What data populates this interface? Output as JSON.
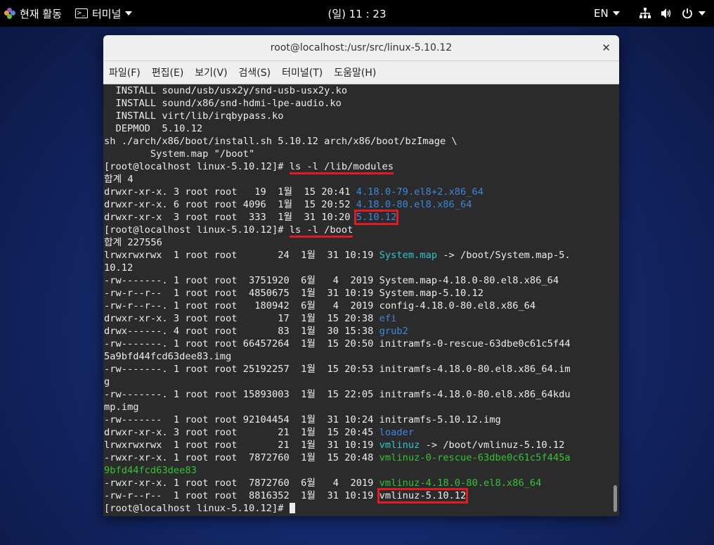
{
  "topbar": {
    "activities": "현재 활동",
    "app_menu": "터미널",
    "clock": "(일) 11 : 23",
    "lang": "EN",
    "icons": [
      "network-icon",
      "volume-icon",
      "power-icon"
    ]
  },
  "window": {
    "title": "root@localhost:/usr/src/linux-5.10.12",
    "menu": [
      "파일(F)",
      "편집(E)",
      "보기(V)",
      "검색(S)",
      "터미널(T)",
      "도움말(H)"
    ]
  },
  "terminal": {
    "colors": {
      "blue": "#3a87e0",
      "cyan": "#2ec4d2",
      "green": "#33c433",
      "highlight": "#e01b24"
    },
    "lines": [
      [
        {
          "t": "  INSTALL sound/usb/usx2y/snd-usb-usx2y.ko"
        }
      ],
      [
        {
          "t": "  INSTALL sound/x86/snd-hdmi-lpe-audio.ko"
        }
      ],
      [
        {
          "t": "  INSTALL virt/lib/irqbypass.ko"
        }
      ],
      [
        {
          "t": "  DEPMOD  5.10.12"
        }
      ],
      [
        {
          "t": "sh ./arch/x86/boot/install.sh 5.10.12 arch/x86/boot/bzImage \\"
        }
      ],
      [
        {
          "t": "        System.map \"/boot\""
        }
      ],
      [
        {
          "t": "[root@localhost linux-5.10.12]# "
        },
        {
          "t": "ls -l /lib/modules",
          "u": true
        }
      ],
      [
        {
          "t": "합계 4"
        }
      ],
      [
        {
          "t": "drwxr-xr-x. 3 root root   19  1월  15 20:41 "
        },
        {
          "t": "4.18.0-79.el8+2.x86_64",
          "c": "blue"
        }
      ],
      [
        {
          "t": "drwxr-xr-x. 6 root root 4096  1월  15 20:52 "
        },
        {
          "t": "4.18.0-80.el8.x86_64",
          "c": "blue"
        }
      ],
      [
        {
          "t": "drwxr-xr-x  3 root root  333  1월  31 10:20 "
        },
        {
          "t": "5.10.12",
          "c": "blue",
          "b": true
        }
      ],
      [
        {
          "t": "[root@localhost linux-5.10.12]# "
        },
        {
          "t": "ls -l /boot",
          "u": true
        }
      ],
      [
        {
          "t": "합계 227556"
        }
      ],
      [
        {
          "t": "lrwxrwxrwx  1 root root       24  1월  31 10:19 "
        },
        {
          "t": "System.map",
          "c": "cyan"
        },
        {
          "t": " -> /boot/System.map-5."
        }
      ],
      [
        {
          "t": "10.12"
        }
      ],
      [
        {
          "t": "-rw-------. 1 root root  3751920  6월   4  2019 System.map-4.18.0-80.el8.x86_64"
        }
      ],
      [
        {
          "t": "-rw-r--r--  1 root root  4850675  1월  31 10:19 System.map-5.10.12"
        }
      ],
      [
        {
          "t": "-rw-r--r--. 1 root root   180942  6월   4  2019 config-4.18.0-80.el8.x86_64"
        }
      ],
      [
        {
          "t": "drwxr-xr-x. 3 root root       17  1월  15 20:38 "
        },
        {
          "t": "efi",
          "c": "blue"
        }
      ],
      [
        {
          "t": "drwx------. 4 root root       83  1월  30 15:38 "
        },
        {
          "t": "grub2",
          "c": "blue"
        }
      ],
      [
        {
          "t": "-rw-------. 1 root root 66457264  1월  15 20:50 initramfs-0-rescue-63dbe0c61c5f44"
        }
      ],
      [
        {
          "t": "5a9bfd44fcd63dee83.img"
        }
      ],
      [
        {
          "t": "-rw-------. 1 root root 25192257  1월  15 20:53 initramfs-4.18.0-80.el8.x86_64.im"
        }
      ],
      [
        {
          "t": "g"
        }
      ],
      [
        {
          "t": "-rw-------. 1 root root 15893003  1월  15 22:05 initramfs-4.18.0-80.el8.x86_64kdu"
        }
      ],
      [
        {
          "t": "mp.img"
        }
      ],
      [
        {
          "t": "-rw-------  1 root root 92104454  1월  31 10:24 initramfs-5.10.12.img"
        }
      ],
      [
        {
          "t": "drwxr-xr-x. 3 root root       21  1월  15 20:45 "
        },
        {
          "t": "loader",
          "c": "blue"
        }
      ],
      [
        {
          "t": "lrwxrwxrwx  1 root root       21  1월  31 10:19 "
        },
        {
          "t": "vmlinuz",
          "c": "cyan"
        },
        {
          "t": " -> /boot/vmlinuz-5.10.12"
        }
      ],
      [
        {
          "t": "-rwxr-xr-x. 1 root root  7872760  1월  15 20:48 "
        },
        {
          "t": "vmlinuz-0-rescue-63dbe0c61c5f445a",
          "c": "green"
        }
      ],
      [
        {
          "t": "9bfd44fcd63dee83",
          "c": "green"
        }
      ],
      [
        {
          "t": "-rwxr-xr-x. 1 root root  7872760  6월   4  2019 "
        },
        {
          "t": "vmlinuz-4.18.0-80.el8.x86_64",
          "c": "green"
        }
      ],
      [
        {
          "t": "-rw-r--r--  1 root root  8816352  1월  31 10:19 "
        },
        {
          "t": "vmlinuz-5.10.12",
          "b": true
        }
      ],
      [
        {
          "t": "[root@localhost linux-5.10.12]# "
        }
      ]
    ]
  }
}
